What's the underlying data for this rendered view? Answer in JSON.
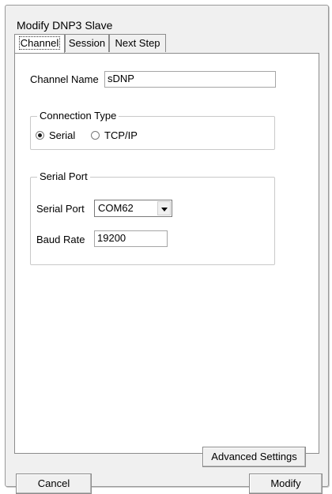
{
  "window": {
    "title": "Modify DNP3 Slave"
  },
  "tabs": [
    {
      "label": "Channel",
      "active": true
    },
    {
      "label": "Session",
      "active": false
    },
    {
      "label": "Next Step",
      "active": false
    }
  ],
  "channel": {
    "name_label": "Channel Name",
    "name_value": "sDNP",
    "connection_type": {
      "group_title": "Connection Type",
      "options": [
        {
          "label": "Serial",
          "selected": true
        },
        {
          "label": "TCP/IP",
          "selected": false
        }
      ]
    },
    "serial_port": {
      "group_title": "Serial Port",
      "port_label": "Serial Port",
      "port_value": "COM62",
      "baud_label": "Baud Rate",
      "baud_value": "19200"
    }
  },
  "buttons": {
    "advanced": "Advanced Settings",
    "cancel": "Cancel",
    "modify": "Modify"
  }
}
